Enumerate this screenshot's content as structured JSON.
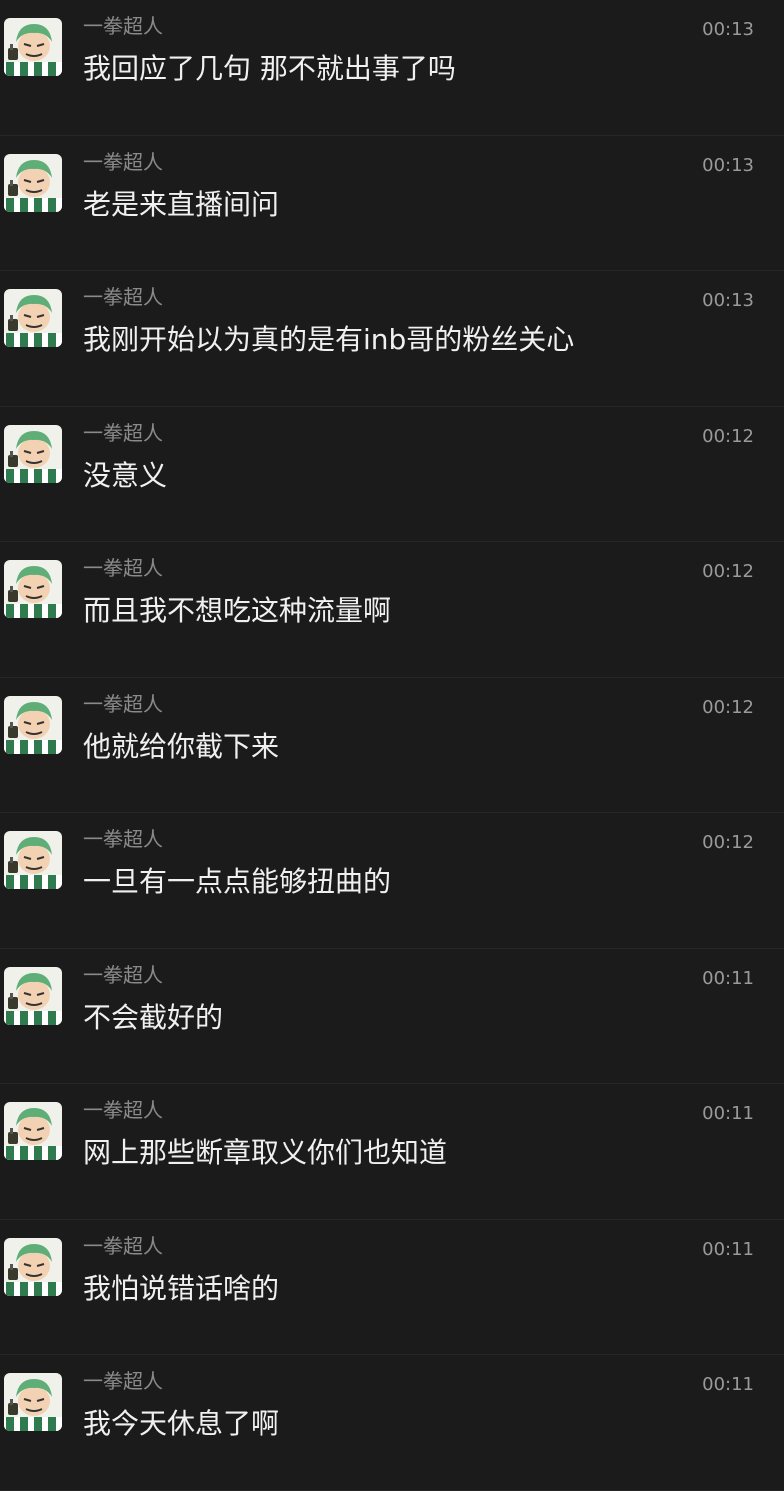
{
  "messages": [
    {
      "sender": "一拳超人",
      "time": "00:13",
      "text": "我回应了几句 那不就出事了吗",
      "avatar": "zoro-avatar"
    },
    {
      "sender": "一拳超人",
      "time": "00:13",
      "text": "老是来直播间问",
      "avatar": "zoro-avatar"
    },
    {
      "sender": "一拳超人",
      "time": "00:13",
      "text": "我刚开始以为真的是有inb哥的粉丝关心",
      "avatar": "zoro-avatar"
    },
    {
      "sender": "一拳超人",
      "time": "00:12",
      "text": "没意义",
      "avatar": "zoro-avatar"
    },
    {
      "sender": "一拳超人",
      "time": "00:12",
      "text": "而且我不想吃这种流量啊",
      "avatar": "zoro-avatar"
    },
    {
      "sender": "一拳超人",
      "time": "00:12",
      "text": "他就给你截下来",
      "avatar": "zoro-avatar"
    },
    {
      "sender": "一拳超人",
      "time": "00:12",
      "text": "一旦有一点点能够扭曲的",
      "avatar": "zoro-avatar"
    },
    {
      "sender": "一拳超人",
      "time": "00:11",
      "text": "不会截好的",
      "avatar": "zoro-avatar"
    },
    {
      "sender": "一拳超人",
      "time": "00:11",
      "text": "网上那些断章取义你们也知道",
      "avatar": "zoro-avatar"
    },
    {
      "sender": "一拳超人",
      "time": "00:11",
      "text": "我怕说错话啥的",
      "avatar": "zoro-avatar"
    },
    {
      "sender": "一拳超人",
      "time": "00:11",
      "text": "我今天休息了啊",
      "avatar": "zoro-avatar"
    }
  ],
  "colors": {
    "background": "#1b1b1b",
    "sender": "#8a8a8a",
    "time": "#9a9a9a",
    "text": "#f0f0f0",
    "avatar_hair": "#5fae78",
    "avatar_stripe": "#2f7a4e"
  }
}
